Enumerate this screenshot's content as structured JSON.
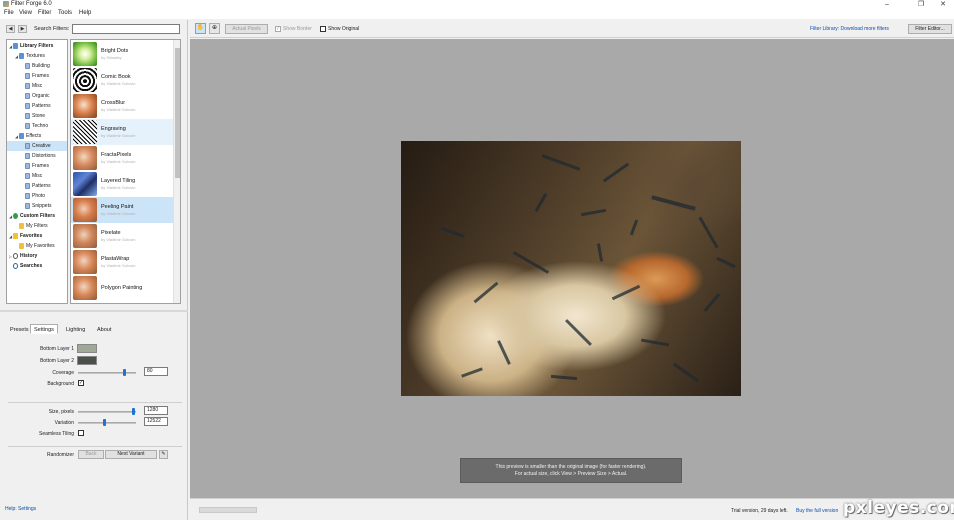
{
  "window": {
    "title": "Filter Forge 6.0",
    "minimize": "–",
    "maximize": "❐",
    "close": "✕"
  },
  "menu": [
    "File",
    "View",
    "Filter",
    "Tools",
    "Help"
  ],
  "search": {
    "label": "Search Filters:",
    "value": "",
    "back": "◀",
    "forward": "▶"
  },
  "tree": [
    {
      "label": "Library Filters",
      "arrow": "◢",
      "icon": "lib",
      "bold": true
    },
    {
      "label": "Textures",
      "arrow": "◢",
      "icon": "lib"
    },
    {
      "label": "Building",
      "icon": "page"
    },
    {
      "label": "Frames",
      "icon": "page"
    },
    {
      "label": "Misc",
      "icon": "page"
    },
    {
      "label": "Organic",
      "icon": "page"
    },
    {
      "label": "Patterns",
      "icon": "page"
    },
    {
      "label": "Stone",
      "icon": "page"
    },
    {
      "label": "Techno",
      "icon": "page"
    },
    {
      "label": "Effects",
      "arrow": "◢",
      "icon": "lib"
    },
    {
      "label": "Creative",
      "icon": "page",
      "selected": true
    },
    {
      "label": "Distortions",
      "icon": "page"
    },
    {
      "label": "Frames",
      "icon": "page"
    },
    {
      "label": "Misc",
      "icon": "page"
    },
    {
      "label": "Patterns",
      "icon": "page"
    },
    {
      "label": "Photo",
      "icon": "page"
    },
    {
      "label": "Snippets",
      "icon": "page"
    },
    {
      "label": "Custom Filters",
      "arrow": "◢",
      "icon": "globe",
      "bold": true
    },
    {
      "label": "My Filters",
      "icon": "folder"
    },
    {
      "label": "Favorites",
      "arrow": "◢",
      "icon": "star",
      "bold": true
    },
    {
      "label": "My Favorites",
      "icon": "folder"
    },
    {
      "label": "History",
      "arrow": "▷",
      "icon": "clock",
      "bold": true
    },
    {
      "label": "Searches",
      "icon": "mag",
      "bold": true
    }
  ],
  "filters": [
    {
      "name": "Bright Dots",
      "author": "by Skinafey"
    },
    {
      "name": "Comic Book",
      "author": "by Vladimir Golovin"
    },
    {
      "name": "CrossBlur",
      "author": "by Vladimir Golovin"
    },
    {
      "name": "Engraving",
      "author": "by Vladimir Golovin"
    },
    {
      "name": "FractaPixels",
      "author": "by Vladimir Golovin"
    },
    {
      "name": "Layered Tiling",
      "author": "by Vladimir Golovin"
    },
    {
      "name": "Peeling Paint",
      "author": "by Vladimir Golovin"
    },
    {
      "name": "Pixelate",
      "author": "by Vladimir Golovin"
    },
    {
      "name": "PlastaWrap",
      "author": "by Vladimir Golovin"
    },
    {
      "name": "Polygon Painting",
      "author": ""
    }
  ],
  "tabs": [
    "Presets",
    "Settings",
    "Lighting",
    "About"
  ],
  "settings": {
    "bottom_layer_1": {
      "label": "Bottom Layer 1",
      "color": "#a0a898"
    },
    "bottom_layer_2": {
      "label": "Bottom Layer 2",
      "color": "#4b514a"
    },
    "coverage": {
      "label": "Coverage",
      "value": "80",
      "level": 0.8
    },
    "background": {
      "label": "Background",
      "checked": "✓"
    },
    "size": {
      "label": "Size, pixels",
      "value": "1280",
      "level": 0.95
    },
    "variation": {
      "label": "Variation",
      "value": "12522",
      "level": 0.45
    },
    "seamless": {
      "label": "Seamless Tiling",
      "checked": ""
    },
    "randomizer": {
      "label": "Randomizer",
      "back": "Back",
      "next": "Next Variant",
      "icon_glyph": "✎"
    }
  },
  "help": {
    "text": "Help: Settings"
  },
  "toolbar": {
    "hand_glyph": "✋",
    "zoom_glyph": "⊕",
    "actual_pixels": "Actual Pixels",
    "show_border": "Show Border",
    "show_original": "Show Original",
    "library_link": "Filter Library: Download more filters",
    "filter_editor": "Filter Editor..."
  },
  "preview_notice": {
    "line1": "This preview is smaller than the original image (for faster rendering).",
    "line2": "For actual size, click View > Preview Size > Actual."
  },
  "status": {
    "trial": "Trial version, 29 days left.",
    "buy": "Buy the full version"
  },
  "watermark": "pxleyes.com"
}
